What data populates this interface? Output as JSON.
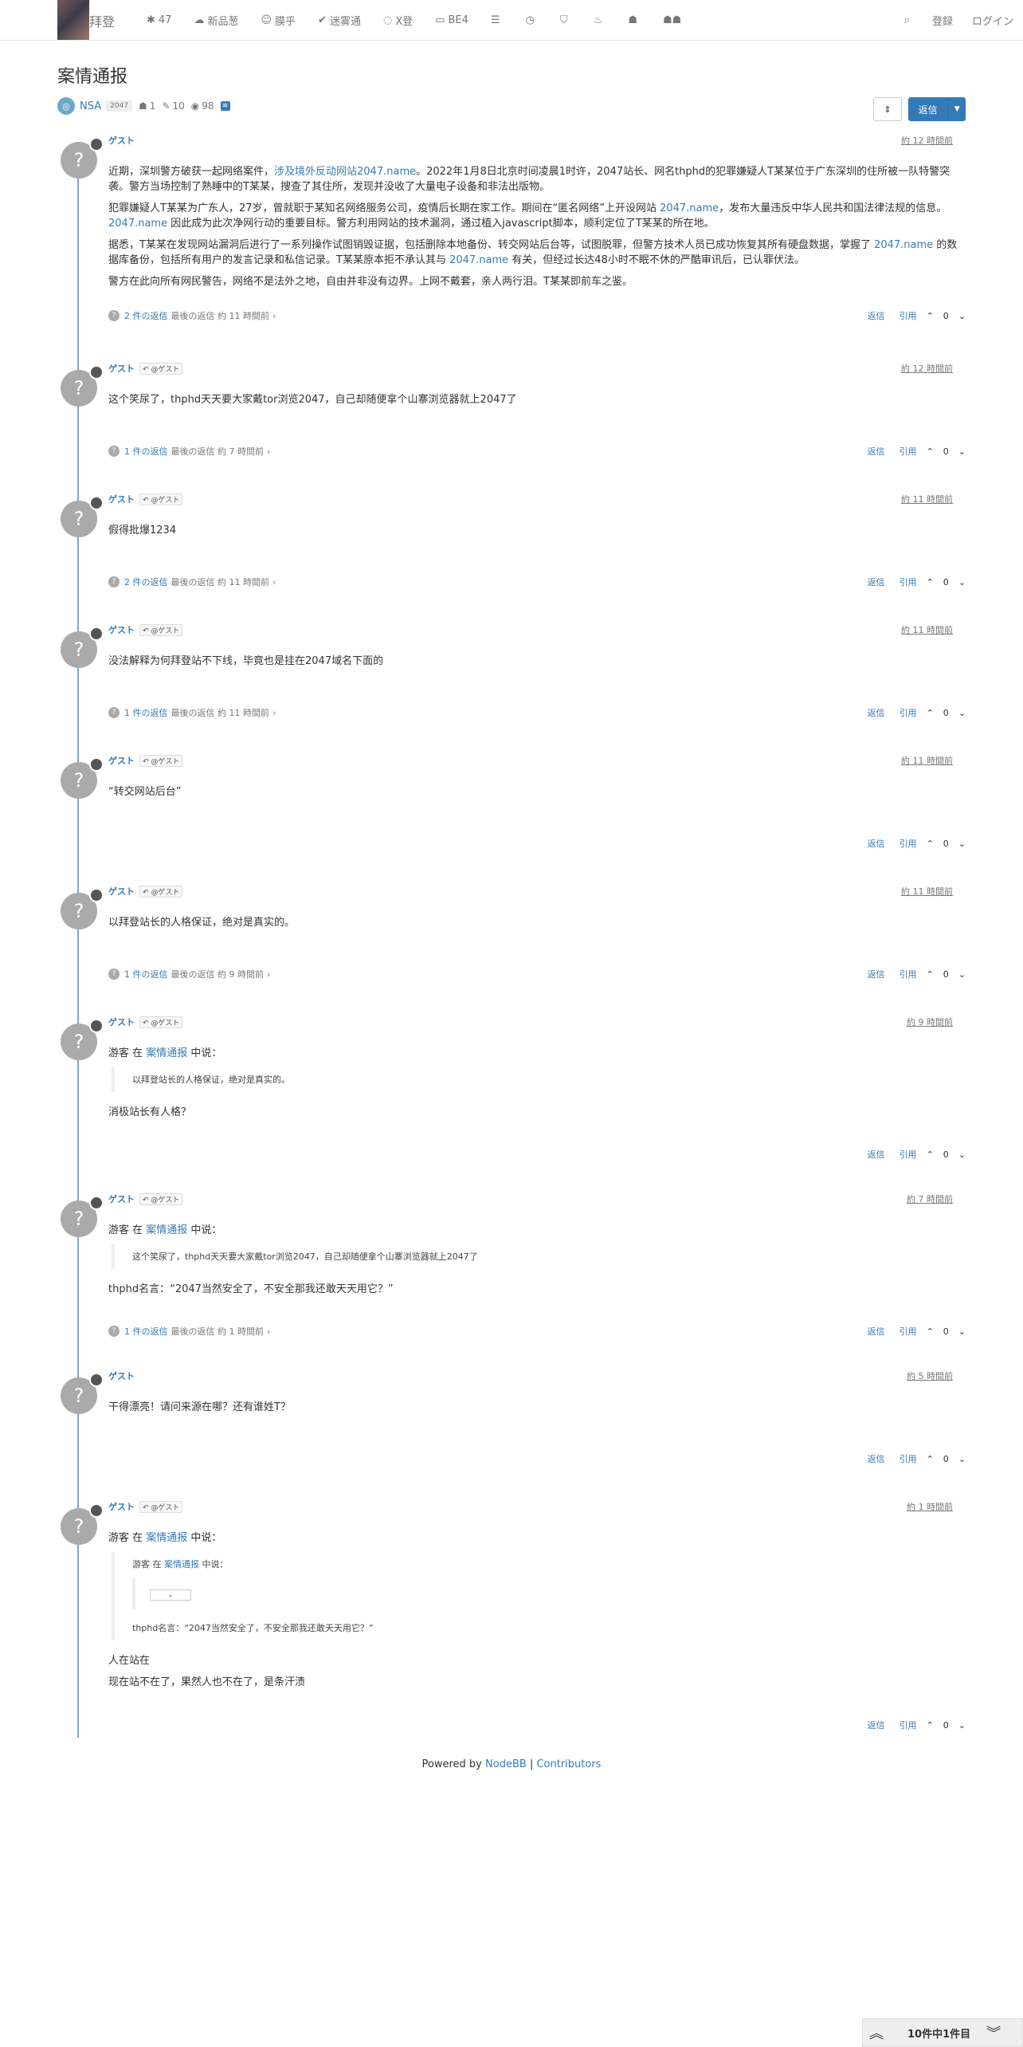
{
  "nav": {
    "brand": "拜登",
    "items": [
      {
        "icon": "✱",
        "label": "47"
      },
      {
        "icon": "☁",
        "label": "新品葱"
      },
      {
        "icon": "☺",
        "label": "膜乎"
      },
      {
        "icon": "✔",
        "label": "迷雾通"
      },
      {
        "icon": "◌",
        "label": "X登"
      },
      {
        "icon": "▭",
        "label": "BE4"
      },
      {
        "icon": "☰",
        "label": ""
      },
      {
        "icon": "◷",
        "label": ""
      },
      {
        "icon": "⛉",
        "label": ""
      },
      {
        "icon": "♨",
        "label": ""
      },
      {
        "icon": "☗",
        "label": ""
      },
      {
        "icon": "☗☗",
        "label": ""
      }
    ],
    "search_icon": "⌕",
    "register": "登録",
    "login": "ログイン"
  },
  "topic": {
    "title": "案情通报",
    "category": "NSA",
    "tag": "2047",
    "posters": "1",
    "posts": "10",
    "views": "98",
    "reply_button": "返信"
  },
  "posts": [
    {
      "user": "ゲスト",
      "parent": "",
      "time": "約 12 時間前",
      "paragraphs": [
        [
          "近期，深圳警方破获一起网络案件，",
          {
            "link": "涉及境外反动网站2047.name"
          },
          "。2022年1月8日北京时间凌晨1时许，2047站长、网名thphd的犯罪嫌疑人T某某位于广东深圳的住所被一队特警突袭。警方当场控制了熟睡中的T某某，搜查了其住所，发现并没收了大量电子设备和非法出版物。"
        ],
        [
          "犯罪嫌疑人T某某为广东人，27岁，曾就职于某知名网络服务公司，疫情后长期在家工作。期间在“匿名网络”上开设网站 ",
          {
            "link": "2047.name"
          },
          "，发布大量违反中华人民共和国法律法规的信息。",
          {
            "link": "2047.name"
          },
          " 因此成为此次净网行动的重要目标。警方利用网站的技术漏洞，通过植入javascript脚本，顺利定位了T某某的所在地。"
        ],
        [
          "据悉，T某某在发现网站漏洞后进行了一系列操作试图销毁证据，包括删除本地备份、转交网站后台等，试图脱罪，但警方技术人员已成功恢复其所有硬盘数据，掌握了 ",
          {
            "link": "2047.name"
          },
          " 的数据库备份，包括所有用户的发言记录和私信记录。T某某原本拒不承认其与 ",
          {
            "link": "2047.name"
          },
          " 有关，但经过长达48小时不眠不休的严酷审讯后，已认罪伏法。"
        ],
        [
          "警方在此向所有网民警告，网络不是法外之地，自由并非没有边界。上网不戴套，亲人两行泪。T某某即前车之鉴。"
        ]
      ],
      "replies": "2 件の返信",
      "last_reply": "最後の返信 約 11 時間前",
      "reply": "返信",
      "quote": "引用",
      "votes": "0"
    },
    {
      "user": "ゲスト",
      "parent": "@ゲスト",
      "time": "約 12 時間前",
      "paragraphs": [
        [
          "这个笑尿了，thphd天天要大家戴tor浏览2047，自己却随便拿个山寨浏览器就上2047了"
        ]
      ],
      "replies": "1 件の返信",
      "last_reply": "最後の返信 約 7 時間前",
      "reply": "返信",
      "quote": "引用",
      "votes": "0"
    },
    {
      "user": "ゲスト",
      "parent": "@ゲスト",
      "time": "約 11 時間前",
      "paragraphs": [
        [
          "假得批爆1234"
        ]
      ],
      "replies": "2 件の返信",
      "last_reply": "最後の返信 約 11 時間前",
      "reply": "返信",
      "quote": "引用",
      "votes": "0"
    },
    {
      "user": "ゲスト",
      "parent": "@ゲスト",
      "time": "約 11 時間前",
      "paragraphs": [
        [
          "没法解释为何拜登站不下线，毕竟也是挂在2047域名下面的"
        ]
      ],
      "replies": "1 件の返信",
      "last_reply": "最後の返信 約 11 時間前",
      "reply": "返信",
      "quote": "引用",
      "votes": "0"
    },
    {
      "user": "ゲスト",
      "parent": "@ゲスト",
      "time": "約 11 時間前",
      "paragraphs": [
        [
          "“转交网站后台”"
        ]
      ],
      "replies": "",
      "last_reply": "",
      "reply": "返信",
      "quote": "引用",
      "votes": "0"
    },
    {
      "user": "ゲスト",
      "parent": "@ゲスト",
      "time": "約 11 時間前",
      "paragraphs": [
        [
          "以拜登站长的人格保证，绝对是真实的。"
        ]
      ],
      "replies": "1 件の返信",
      "last_reply": "最後の返信 約 9 時間前",
      "reply": "返信",
      "quote": "引用",
      "votes": "0"
    },
    {
      "user": "ゲスト",
      "parent": "@ゲスト",
      "time": "約 9 時間前",
      "quote_intro": [
        "游客 在 ",
        {
          "link": "案情通报"
        },
        " 中说："
      ],
      "quote_text": "以拜登站长的人格保证，绝对是真实的。",
      "paragraphs": [
        [
          "消极站长有人格？"
        ]
      ],
      "replies": "",
      "last_reply": "",
      "reply": "返信",
      "quote": "引用",
      "votes": "0"
    },
    {
      "user": "ゲスト",
      "parent": "@ゲスト",
      "time": "約 7 時間前",
      "quote_intro": [
        "游客 在 ",
        {
          "link": "案情通报"
        },
        " 中说："
      ],
      "quote_text": "这个笑尿了，thphd天天要大家戴tor浏览2047，自己却随便拿个山寨浏览器就上2047了",
      "paragraphs": [
        [
          "thphd名言：“2047当然安全了，不安全那我还敢天天用它？”"
        ]
      ],
      "replies": "1 件の返信",
      "last_reply": "最後の返信 約 1 時間前",
      "reply": "返信",
      "quote": "引用",
      "votes": "0"
    },
    {
      "user": "ゲスト",
      "parent": "",
      "time": "約 5 時間前",
      "paragraphs": [
        [
          "干得漂亮！请问来源在哪？还有谁姓T？"
        ]
      ],
      "replies": "",
      "last_reply": "",
      "reply": "返信",
      "quote": "引用",
      "votes": "0"
    },
    {
      "user": "ゲスト",
      "parent": "@ゲスト",
      "time": "約 1 時間前",
      "quote_intro": [
        "游客 在 ",
        {
          "link": "案情通报"
        },
        " 中说："
      ],
      "nested_intro": [
        "游客 在 ",
        {
          "link": "案情通报"
        },
        " 中说："
      ],
      "quote_text": "thphd名言：“2047当然安全了，不安全那我还敢天天用它？”",
      "paragraphs": [
        [
          "人在站在"
        ],
        [
          "现在站不在了，果然人也不在了，是条汗渍"
        ]
      ],
      "replies": "",
      "last_reply": "",
      "reply": "返信",
      "quote": "引用",
      "votes": "0"
    }
  ],
  "footer": {
    "powered": "Powered by",
    "nodebb": "NodeBB",
    "sep": "|",
    "contributors": "Contributors"
  },
  "pager": {
    "text": "10件中1件目"
  }
}
